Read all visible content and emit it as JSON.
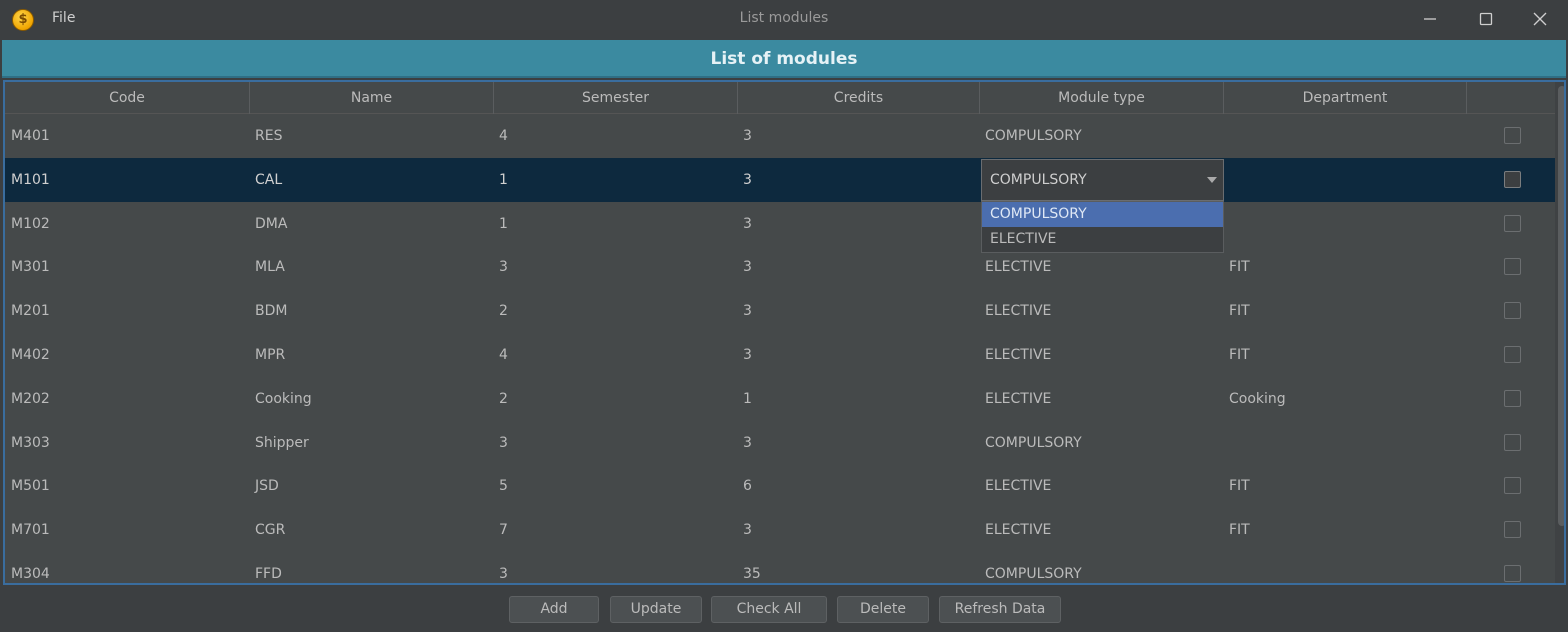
{
  "window": {
    "menu_file": "File",
    "title": "List modules",
    "app_icon_glyph": "$"
  },
  "banner": {
    "title": "List of modules"
  },
  "table": {
    "columns": [
      "Code",
      "Name",
      "Semester",
      "Credits",
      "Module type",
      "Department",
      ""
    ],
    "rows": [
      {
        "code": "M401",
        "name": "RES",
        "semester": "4",
        "credits": "3",
        "type": "COMPULSORY",
        "department": ""
      },
      {
        "code": "M101",
        "name": "CAL",
        "semester": "1",
        "credits": "3",
        "type": "",
        "department": ""
      },
      {
        "code": "M102",
        "name": "DMA",
        "semester": "1",
        "credits": "3",
        "type": "",
        "department": ""
      },
      {
        "code": "M301",
        "name": "MLA",
        "semester": "3",
        "credits": "3",
        "type": "ELECTIVE",
        "department": "FIT"
      },
      {
        "code": "M201",
        "name": "BDM",
        "semester": "2",
        "credits": "3",
        "type": "ELECTIVE",
        "department": "FIT"
      },
      {
        "code": "M402",
        "name": "MPR",
        "semester": "4",
        "credits": "3",
        "type": "ELECTIVE",
        "department": "FIT"
      },
      {
        "code": "M202",
        "name": "Cooking",
        "semester": "2",
        "credits": "1",
        "type": "ELECTIVE",
        "department": "Cooking"
      },
      {
        "code": "M303",
        "name": "Shipper",
        "semester": "3",
        "credits": "3",
        "type": "COMPULSORY",
        "department": ""
      },
      {
        "code": "M501",
        "name": "JSD",
        "semester": "5",
        "credits": "6",
        "type": "ELECTIVE",
        "department": "FIT"
      },
      {
        "code": "M701",
        "name": "CGR",
        "semester": "7",
        "credits": "3",
        "type": "ELECTIVE",
        "department": "FIT"
      },
      {
        "code": "M304",
        "name": "FFD",
        "semester": "3",
        "credits": "35",
        "type": "COMPULSORY",
        "department": ""
      }
    ],
    "selected_row": 1
  },
  "combo": {
    "value": "COMPULSORY",
    "options": [
      "COMPULSORY",
      "ELECTIVE"
    ],
    "highlighted": 0
  },
  "buttons": {
    "add": "Add",
    "update": "Update",
    "check_all": "Check All",
    "delete": "Delete",
    "refresh": "Refresh Data"
  },
  "colors": {
    "banner": "#3b8aa0",
    "selected_row": "#0d293e",
    "dropdown_highlight": "#4b6eaf",
    "table_border": "#3a6d9e"
  }
}
